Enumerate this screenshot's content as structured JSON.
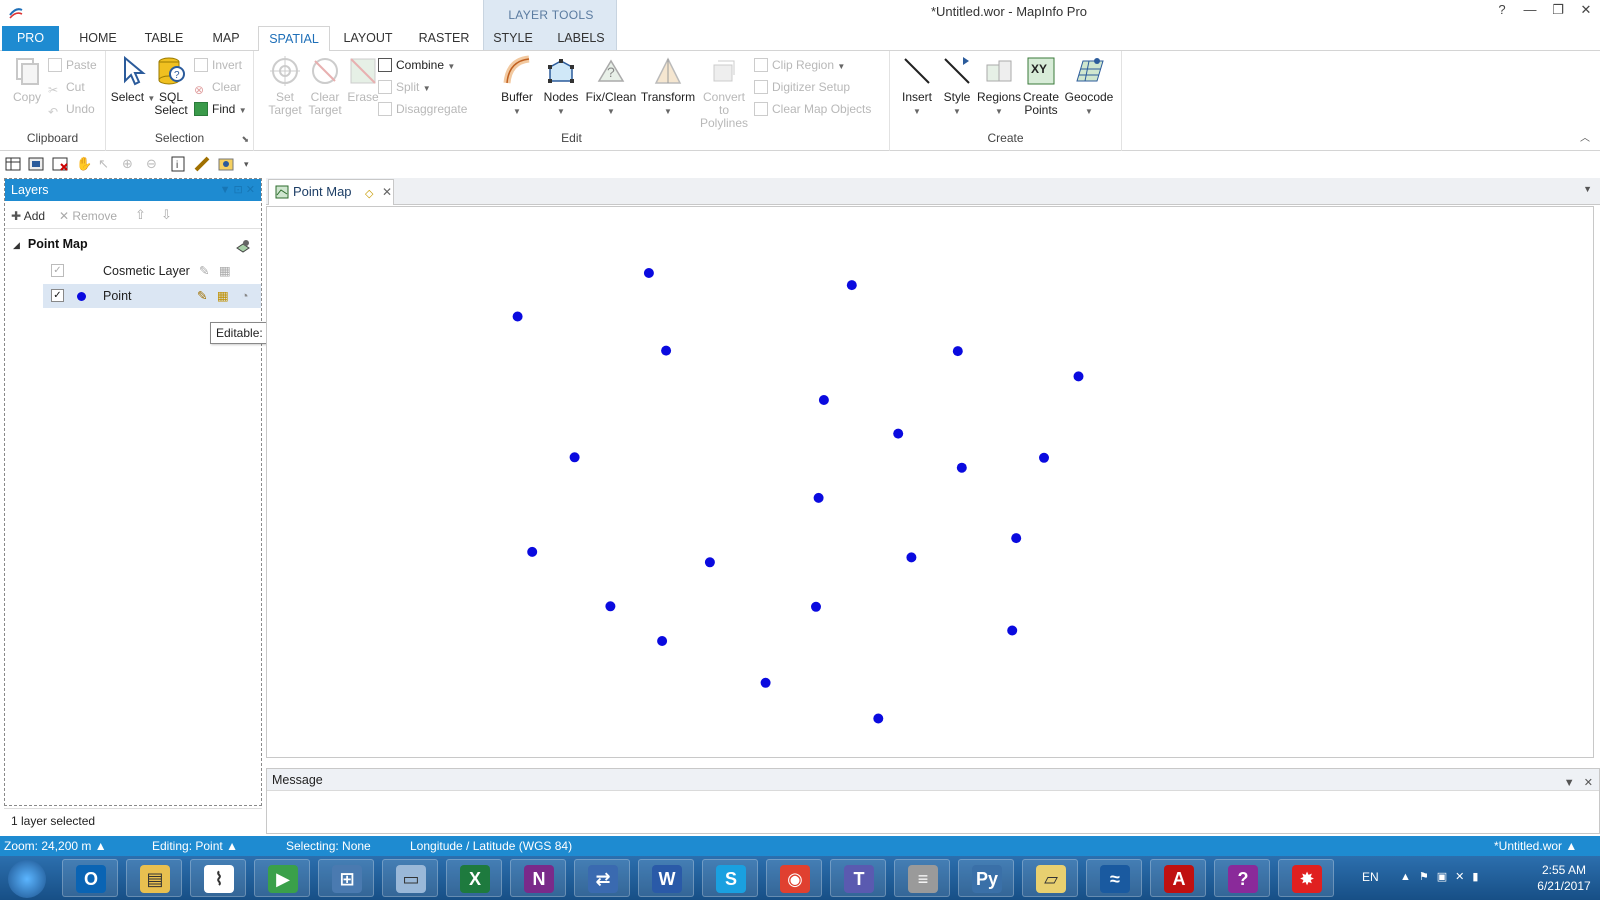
{
  "window": {
    "title": "*Untitled.wor - MapInfo Pro",
    "controls": [
      "?",
      "—",
      "❐",
      "✕"
    ]
  },
  "contextual_group": "LAYER TOOLS",
  "tabs": [
    "PRO",
    "HOME",
    "TABLE",
    "MAP",
    "SPATIAL",
    "LAYOUT",
    "RASTER",
    "STYLE",
    "LABELS"
  ],
  "ribbon": {
    "clipboard": {
      "label": "Clipboard",
      "copy": "Copy",
      "paste": "Paste",
      "cut": "Cut",
      "undo": "Undo"
    },
    "selection": {
      "label": "Selection",
      "select": "Select",
      "sql_select_1": "SQL",
      "sql_select_2": "Select",
      "invert": "Invert",
      "clear": "Clear",
      "find": "Find"
    },
    "edit": {
      "label": "Edit",
      "set_target_1": "Set",
      "set_target_2": "Target",
      "clear_target_1": "Clear",
      "clear_target_2": "Target",
      "erase": "Erase",
      "combine": "Combine",
      "split": "Split",
      "disaggregate": "Disaggregate",
      "buffer": "Buffer",
      "nodes": "Nodes",
      "fix_clean": "Fix/Clean",
      "transform": "Transform",
      "convert_1": "Convert to",
      "convert_2": "Polylines",
      "clip_region": "Clip Region",
      "digitizer_setup": "Digitizer Setup",
      "clear_map_objects": "Clear Map Objects"
    },
    "create": {
      "label": "Create",
      "insert": "Insert",
      "style": "Style",
      "regions": "Regions",
      "create_points_1": "Create",
      "create_points_2": "Points",
      "geocode": "Geocode"
    }
  },
  "layers_panel": {
    "title": "Layers",
    "add": "Add",
    "remove": "Remove",
    "map_name": "Point Map",
    "layers": [
      {
        "name": "Cosmetic Layer",
        "checked": true
      },
      {
        "name": "Point",
        "checked": true
      }
    ],
    "tooltip": "Editable: On",
    "footer": "1 layer selected"
  },
  "document": {
    "tab_title": "Point Map",
    "point_color": "#0a0adf",
    "points": [
      [
        0.288,
        0.12
      ],
      [
        0.441,
        0.142
      ],
      [
        0.189,
        0.199
      ],
      [
        0.301,
        0.261
      ],
      [
        0.521,
        0.262
      ],
      [
        0.612,
        0.308
      ],
      [
        0.42,
        0.351
      ],
      [
        0.476,
        0.412
      ],
      [
        0.232,
        0.455
      ],
      [
        0.524,
        0.474
      ],
      [
        0.586,
        0.456
      ],
      [
        0.416,
        0.529
      ],
      [
        0.2,
        0.627
      ],
      [
        0.334,
        0.646
      ],
      [
        0.486,
        0.637
      ],
      [
        0.565,
        0.602
      ],
      [
        0.259,
        0.726
      ],
      [
        0.414,
        0.727
      ],
      [
        0.298,
        0.789
      ],
      [
        0.562,
        0.77
      ],
      [
        0.376,
        0.865
      ],
      [
        0.461,
        0.93
      ]
    ]
  },
  "message_panel": {
    "title": "Message"
  },
  "status": {
    "zoom": "Zoom: 24,200 m",
    "editing": "Editing: Point",
    "selecting": "Selecting: None",
    "projection": "Longitude / Latitude (WGS 84)",
    "workspace": "*Untitled.wor"
  },
  "taskbar": {
    "apps": [
      "outlook-icon",
      "file-explorer-icon",
      "acrobat-icon",
      "media-player-icon",
      "network-icon",
      "notepad-icon",
      "excel-icon",
      "onenote-icon",
      "remote-desktop-icon",
      "word-icon",
      "skype-icon",
      "chrome-icon",
      "teams-icon",
      "database-icon",
      "python-icon",
      "folder-icon",
      "mapinfo-icon",
      "acrobat-reader-icon",
      "help-icon",
      "splat-icon"
    ],
    "language": "EN",
    "time": "2:55 AM",
    "date": "6/21/2017"
  },
  "colors": {
    "accent": "#1e8bd1",
    "contextual": "#dde8f3"
  }
}
